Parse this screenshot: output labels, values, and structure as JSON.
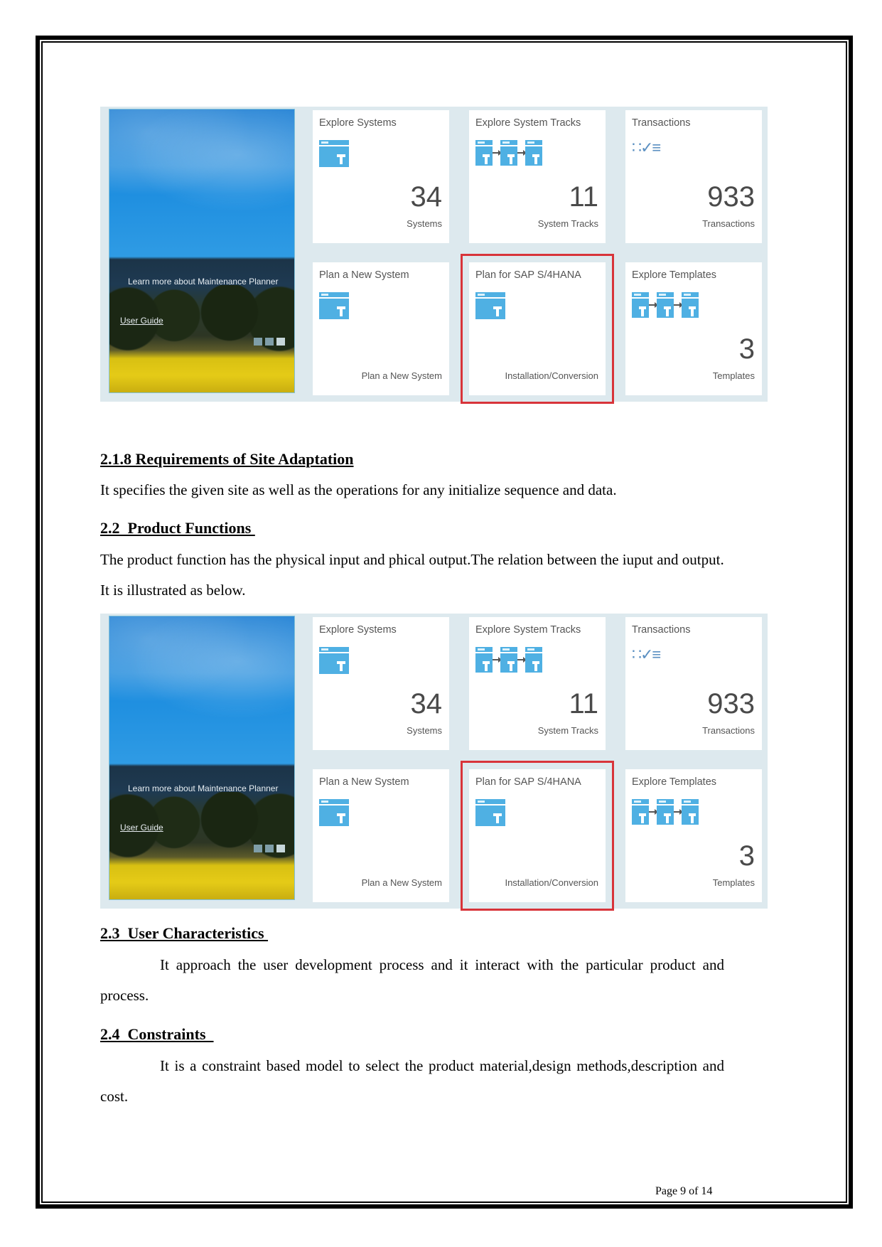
{
  "panel": {
    "hero": {
      "learn_more": "Learn more about Maintenance Planner",
      "user_guide": "User Guide",
      "carousel_pages": 3,
      "carousel_active": 3
    },
    "tiles": [
      {
        "title": "Explore Systems",
        "icon": "system-icon",
        "number": "34",
        "unit": "Systems"
      },
      {
        "title": "Explore System Tracks",
        "icon": "system-track-icon",
        "number": "11",
        "unit": "System Tracks"
      },
      {
        "title": "Transactions",
        "icon": "checklist-icon",
        "number": "933",
        "unit": "Transactions"
      },
      {
        "title": "Plan a New System",
        "icon": "system-icon",
        "number": "",
        "unit": "Plan a New System"
      },
      {
        "title": "Plan for SAP S/4HANA",
        "icon": "system-icon",
        "number": "",
        "unit": "Installation/Conversion",
        "highlighted": true
      },
      {
        "title": "Explore Templates",
        "icon": "system-track-icon",
        "number": "3",
        "unit": "Templates"
      }
    ],
    "highlight_color": "#d8343a"
  },
  "sections": {
    "s218": {
      "heading": "2.1.8 Requirements of Site Adaptation",
      "body": "It specifies the given site as well as the operations for any initialize sequence and data."
    },
    "s22": {
      "heading": "2.2  Product Functions ",
      "body": "The product function has the physical input and phical output.The relation between the iuput and output. It is illustrated as below."
    },
    "s23": {
      "heading": "2.3  User Characteristics ",
      "body": "It approach the user development process and it interact with the particular product and process."
    },
    "s24": {
      "heading": "2.4  Constraints  ",
      "body": "It is a constraint based model to select the product material,design methods,description and cost."
    }
  },
  "footer": {
    "page_label": "Page 9 of 14"
  }
}
